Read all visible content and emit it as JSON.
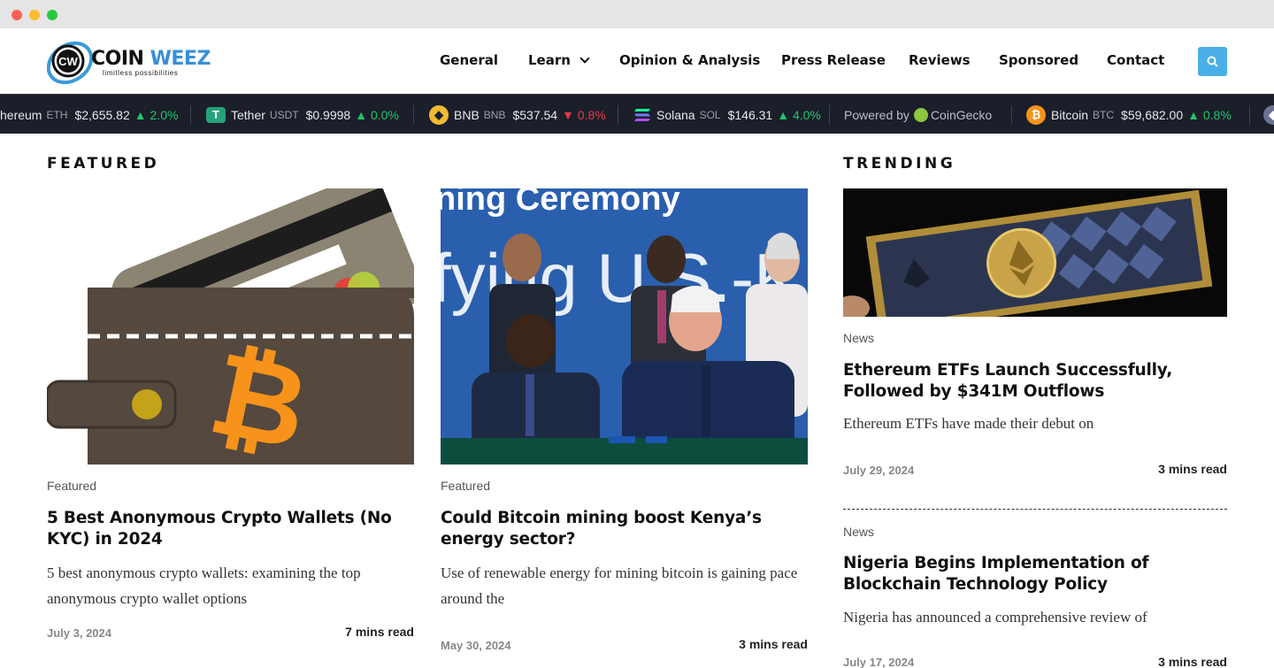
{
  "logo": {
    "text_coin": "COIN",
    "text_weez": "WEEZ",
    "badge": "CW",
    "tagline": "limitless possibilities"
  },
  "nav": {
    "items": [
      "General",
      "Learn",
      "Opinion & Analysis",
      "Press Release",
      "Reviews",
      "Sponsored",
      "Contact"
    ]
  },
  "ticker": {
    "items": [
      {
        "name": "hereum",
        "symbol": "ETH",
        "price": "$2,655.82",
        "change": "2.0%",
        "direction": "up",
        "icon": "ethereum-icon"
      },
      {
        "name": "Tether",
        "symbol": "USDT",
        "price": "$0.9998",
        "change": "0.0%",
        "direction": "up",
        "icon": "tether-icon"
      },
      {
        "name": "BNB",
        "symbol": "BNB",
        "price": "$537.54",
        "change": "0.8%",
        "direction": "down",
        "icon": "bnb-icon"
      },
      {
        "name": "Solana",
        "symbol": "SOL",
        "price": "$146.31",
        "change": "4.0%",
        "direction": "up",
        "icon": "solana-icon"
      },
      {
        "name": "Bitcoin",
        "symbol": "BTC",
        "price": "$59,682.00",
        "change": "0.8%",
        "direction": "up",
        "icon": "bitcoin-icon"
      }
    ],
    "powered_by": "Powered by",
    "powered_brand": "CoinGecko"
  },
  "featured": {
    "heading": "FEATURED",
    "articles": [
      {
        "category": "Featured",
        "title": "5 Best Anonymous Crypto Wallets (No KYC) in 2024",
        "excerpt": "5 best anonymous crypto wallets: examining the top anonymous crypto wallet options",
        "date": "July 3, 2024",
        "read_time": "7 mins read"
      },
      {
        "category": "Featured",
        "title": "Could Bitcoin mining boost Kenya’s energy sector?",
        "excerpt": "Use of renewable energy for mining bitcoin is gaining pace around the",
        "date": "May 30, 2024",
        "read_time": "3 mins read",
        "image_banner_text": "ning Ceremony",
        "image_backdrop_text": "fying U.S.-K"
      }
    ]
  },
  "trending": {
    "heading": "TRENDING",
    "articles": [
      {
        "category": "News",
        "title": "Ethereum ETFs Launch Successfully, Followed by $341M Outflows",
        "excerpt": "Ethereum ETFs have made their debut on",
        "date": "July 29, 2024",
        "read_time": "3 mins read"
      },
      {
        "category": "News",
        "title": "Nigeria Begins Implementation of Blockchain Technology Policy",
        "excerpt": "Nigeria has announced a comprehensive review of",
        "date": "July 17, 2024",
        "read_time": "3 mins read"
      }
    ]
  },
  "colors": {
    "accent": "#4aaee8",
    "ticker_bg": "#1a1f2a",
    "up": "#1fc76a",
    "down": "#e6394a",
    "bitcoin": "#f7931a"
  }
}
